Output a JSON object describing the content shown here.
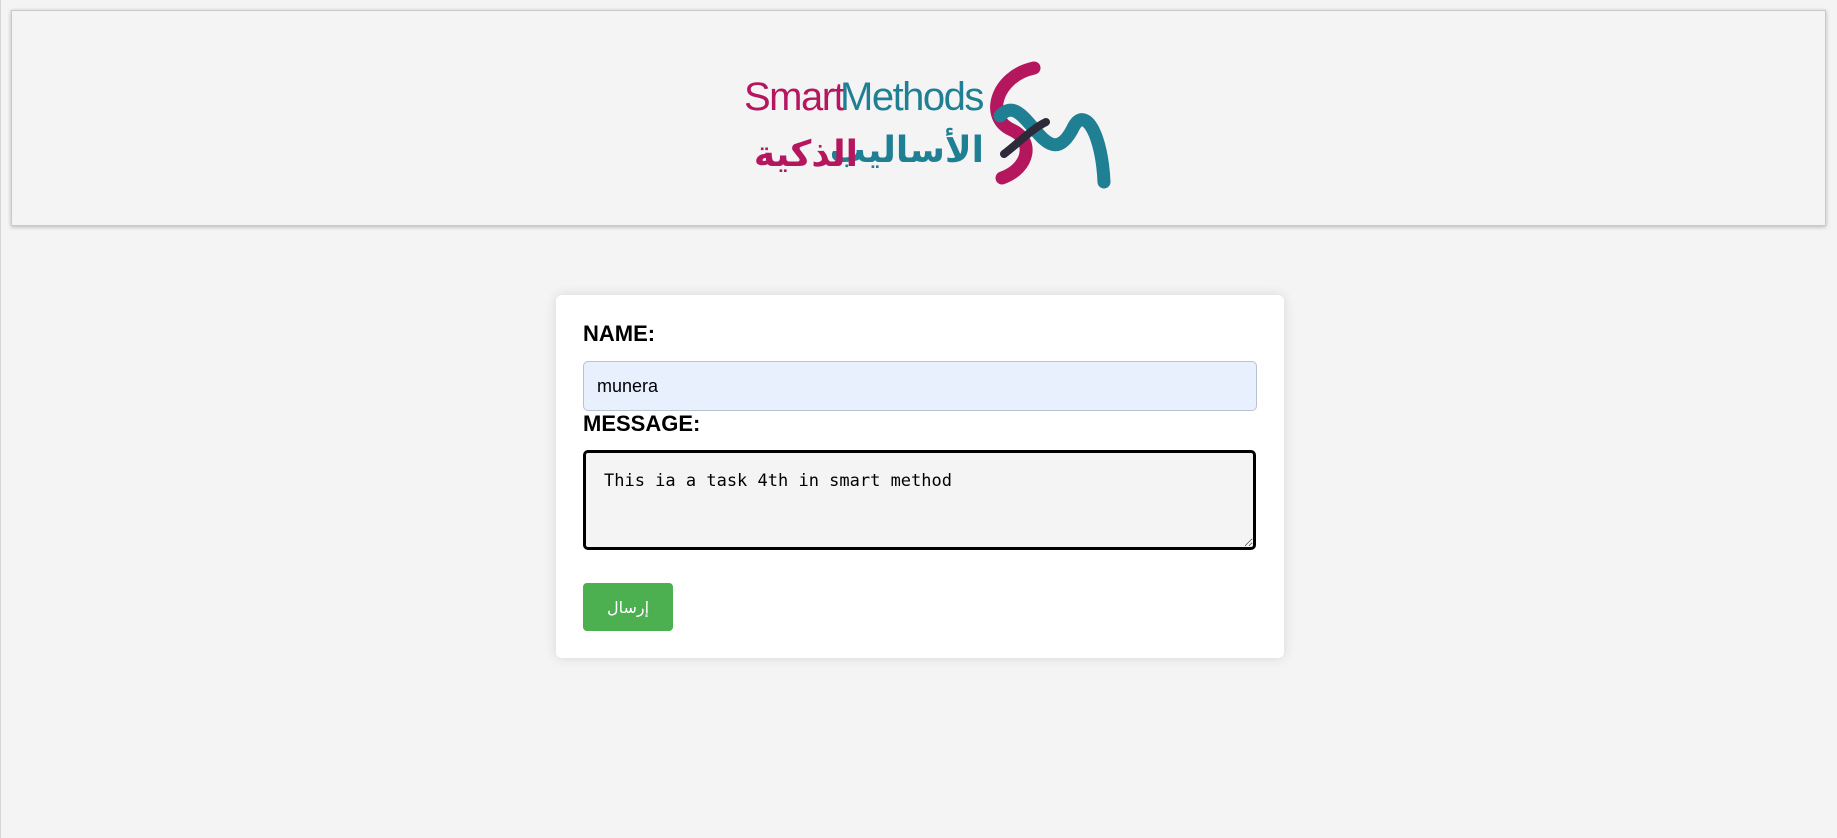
{
  "header": {
    "logo": {
      "name": "Smart Methods logo",
      "text_en_part1": "Smart",
      "text_en_part2": "Methods",
      "text_ar_part1": "الأساليب",
      "text_ar_part2": "الذكية",
      "colors": {
        "magenta": "#b5175f",
        "teal": "#1f7f93",
        "dark": "#2b2b3a"
      }
    }
  },
  "form": {
    "name_label": "NAME:",
    "name_value": "munera",
    "message_label": "MESSAGE:",
    "message_value": "This ia a task 4th in smart method ",
    "submit_label": "إرسال"
  },
  "colors": {
    "page_background": "#f4f4f4",
    "card_background": "#ffffff",
    "name_field_background": "#e8f0fe",
    "button_background": "#4caf50",
    "button_text": "#ffffff"
  }
}
